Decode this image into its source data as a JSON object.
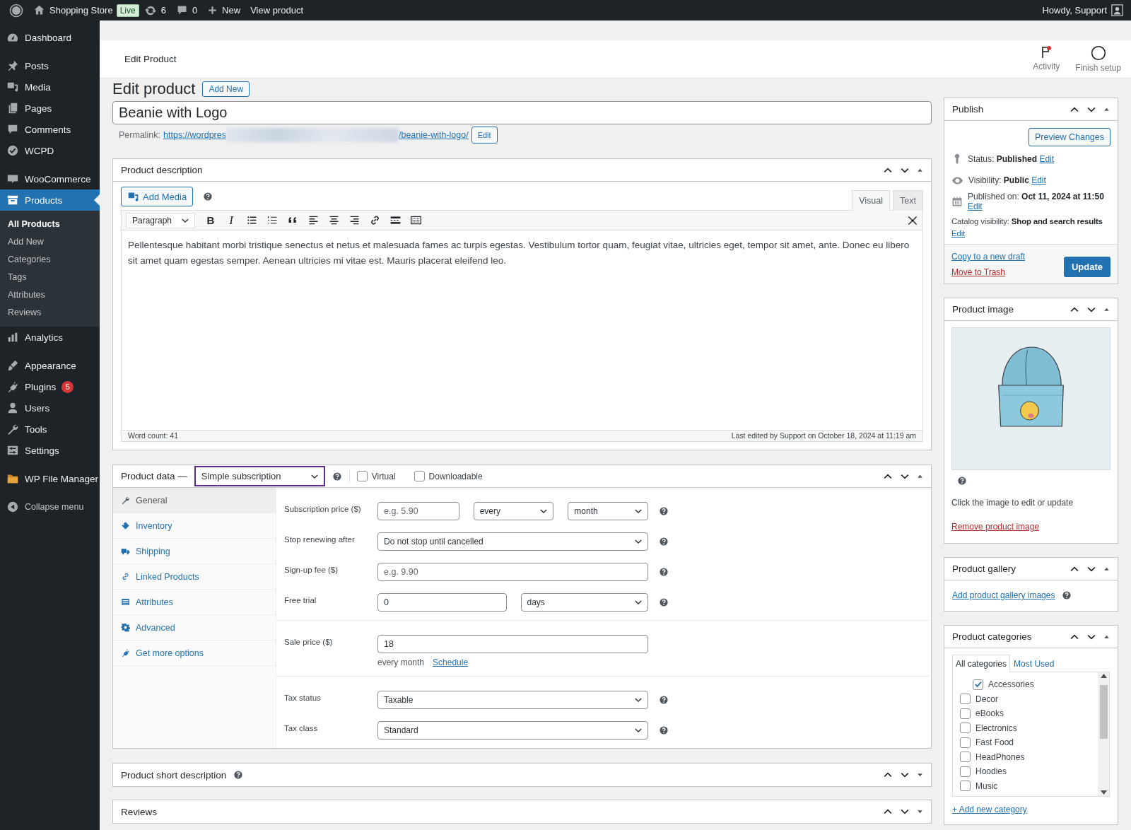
{
  "admin_bar": {
    "site_name": "Shopping Store",
    "badge": "Live",
    "updates": "6",
    "comments": "0",
    "new": "New",
    "view": "View product",
    "account": "Howdy, Support"
  },
  "sidebar": {
    "groups": [
      {
        "items": [
          {
            "label": "Dashboard",
            "selected": false
          }
        ]
      },
      {
        "items": [
          {
            "label": "Posts",
            "selected": false
          },
          {
            "label": "Media",
            "selected": false
          },
          {
            "label": "Pages",
            "selected": false
          },
          {
            "label": "Comments",
            "selected": false
          },
          {
            "label": "WCPD",
            "selected": false
          }
        ]
      },
      {
        "items": [
          {
            "label": "WooCommerce",
            "selected": false
          },
          {
            "label": "Products",
            "selected": true,
            "children": [
              {
                "label": "All Products",
                "selected": true
              },
              {
                "label": "Add New",
                "selected": false
              },
              {
                "label": "Categories",
                "selected": false
              },
              {
                "label": "Tags",
                "selected": false
              },
              {
                "label": "Attributes",
                "selected": false
              },
              {
                "label": "Reviews",
                "selected": false
              }
            ]
          },
          {
            "label": "Analytics",
            "selected": false
          }
        ]
      },
      {
        "items": [
          {
            "label": "Appearance",
            "selected": false
          },
          {
            "label": "Plugins",
            "selected": false,
            "badge": "5"
          },
          {
            "label": "Users",
            "selected": false
          },
          {
            "label": "Tools",
            "selected": false
          },
          {
            "label": "Settings",
            "selected": false
          }
        ]
      },
      {
        "items": [
          {
            "label": "WP File Manager",
            "selected": false
          }
        ]
      }
    ],
    "collapse": "Collapse menu"
  },
  "header": {
    "title": "Edit Product",
    "actions": [
      {
        "label": "Activity"
      },
      {
        "label": "Finish setup"
      }
    ]
  },
  "editor": {
    "heading": "Edit product",
    "add_new": "Add New",
    "title_value": "Beanie with Logo",
    "permalink": {
      "label": "Permalink:",
      "url_start": "https://wordpres",
      "url_end": "/beanie-with-logo/",
      "edit": "Edit"
    },
    "description": {
      "title": "Product description",
      "expanded": true,
      "add_media": "Add Media",
      "tabs": [
        {
          "label": "Visual",
          "selected": true
        },
        {
          "label": "Text",
          "selected": false
        }
      ],
      "format": "Paragraph",
      "bold": "B",
      "italic": "I",
      "body": "Pellentesque habitant morbi tristique senectus et netus et malesuada fames ac turpis egestas. Vestibulum tortor quam, feugiat vitae, ultricies eget, tempor sit amet, ante. Donec eu libero sit amet quam egestas semper. Aenean ultricies mi vitae est. Mauris placerat eleifend leo.",
      "word_count": "Word count: 41",
      "last_edited": "Last edited by Support on October 18, 2024 at 11:19 am"
    },
    "product_data": {
      "title": "Product data —",
      "type": "Simple subscription",
      "expanded": true,
      "options": [
        {
          "label": "Virtual",
          "checked": false
        },
        {
          "label": "Downloadable",
          "checked": false
        }
      ],
      "tabs": [
        {
          "label": "General",
          "selected": true
        },
        {
          "label": "Inventory",
          "selected": false
        },
        {
          "label": "Shipping",
          "selected": false
        },
        {
          "label": "Linked Products",
          "selected": false
        },
        {
          "label": "Attributes",
          "selected": false
        },
        {
          "label": "Advanced",
          "selected": false
        },
        {
          "label": "Get more options",
          "selected": false
        }
      ],
      "groups": [
        {
          "rows": [
            {
              "label": "Subscription price ($)",
              "help": true,
              "controls": [
                {
                  "kind": "input",
                  "placeholder": "e.g. 5.90"
                },
                {
                  "kind": "select",
                  "value": "every"
                },
                {
                  "kind": "select",
                  "value": "month"
                }
              ]
            },
            {
              "label": "Stop renewing after",
              "help": true,
              "controls": [
                {
                  "kind": "select",
                  "value": "Do not stop until cancelled"
                }
              ]
            },
            {
              "label": "Sign-up fee ($)",
              "help": true,
              "controls": [
                {
                  "kind": "input",
                  "placeholder": "e.g. 9.90"
                }
              ]
            },
            {
              "label": "Free trial",
              "help": true,
              "controls": [
                {
                  "kind": "input",
                  "value": "0"
                },
                {
                  "kind": "select",
                  "value": "days"
                }
              ]
            }
          ]
        },
        {
          "rows": [
            {
              "label": "Sale price ($)",
              "help": false,
              "controls": [
                {
                  "kind": "input",
                  "value": "18"
                }
              ],
              "note": "every month",
              "note_link": "Schedule"
            }
          ]
        },
        {
          "rows": [
            {
              "label": "Tax status",
              "help": true,
              "controls": [
                {
                  "kind": "select",
                  "value": "Taxable"
                }
              ]
            },
            {
              "label": "Tax class",
              "help": true,
              "controls": [
                {
                  "kind": "select",
                  "value": "Standard"
                }
              ]
            }
          ]
        }
      ]
    },
    "closed_boxes": [
      {
        "title": "Product short description",
        "help": true,
        "expanded": false
      },
      {
        "title": "Reviews",
        "help": false,
        "expanded": false
      }
    ]
  },
  "publish": {
    "title": "Publish",
    "expanded": true,
    "preview": "Preview Changes",
    "meta": [
      {
        "text": "Status: **Published**",
        "edit": "Edit"
      },
      {
        "text": "Visibility: **Public**",
        "edit": "Edit"
      },
      {
        "text": "Published on: **Oct 11, 2024 at 11:50**",
        "edit": "Edit"
      }
    ],
    "catalog": {
      "text": "Catalog visibility: **Shop and search results**",
      "edit": "Edit"
    },
    "copy": "Copy to a new draft",
    "trash": "Move to Trash",
    "update": "Update"
  },
  "product_image": {
    "title": "Product image",
    "expanded": true,
    "hint": "Click the image to edit or update",
    "remove": "Remove product image"
  },
  "gallery": {
    "title": "Product gallery",
    "expanded": true,
    "add": "Add product gallery images"
  },
  "categories": {
    "title": "Product categories",
    "expanded": true,
    "tabs": [
      {
        "label": "All categories",
        "selected": true
      },
      {
        "label": "Most Used",
        "selected": false
      }
    ],
    "items": [
      {
        "label": "Accessories",
        "checked": true,
        "kind": "child"
      },
      {
        "label": "Decor",
        "checked": false,
        "kind": "top"
      },
      {
        "label": "eBooks",
        "checked": false,
        "kind": "top"
      },
      {
        "label": "Electronics",
        "checked": false,
        "kind": "top"
      },
      {
        "label": "Fast Food",
        "checked": false,
        "kind": "top"
      },
      {
        "label": "HeadPhones",
        "checked": false,
        "kind": "top"
      },
      {
        "label": "Hoodies",
        "checked": false,
        "kind": "top"
      },
      {
        "label": "Music",
        "checked": false,
        "kind": "top"
      }
    ],
    "add": "+ Add new category"
  }
}
